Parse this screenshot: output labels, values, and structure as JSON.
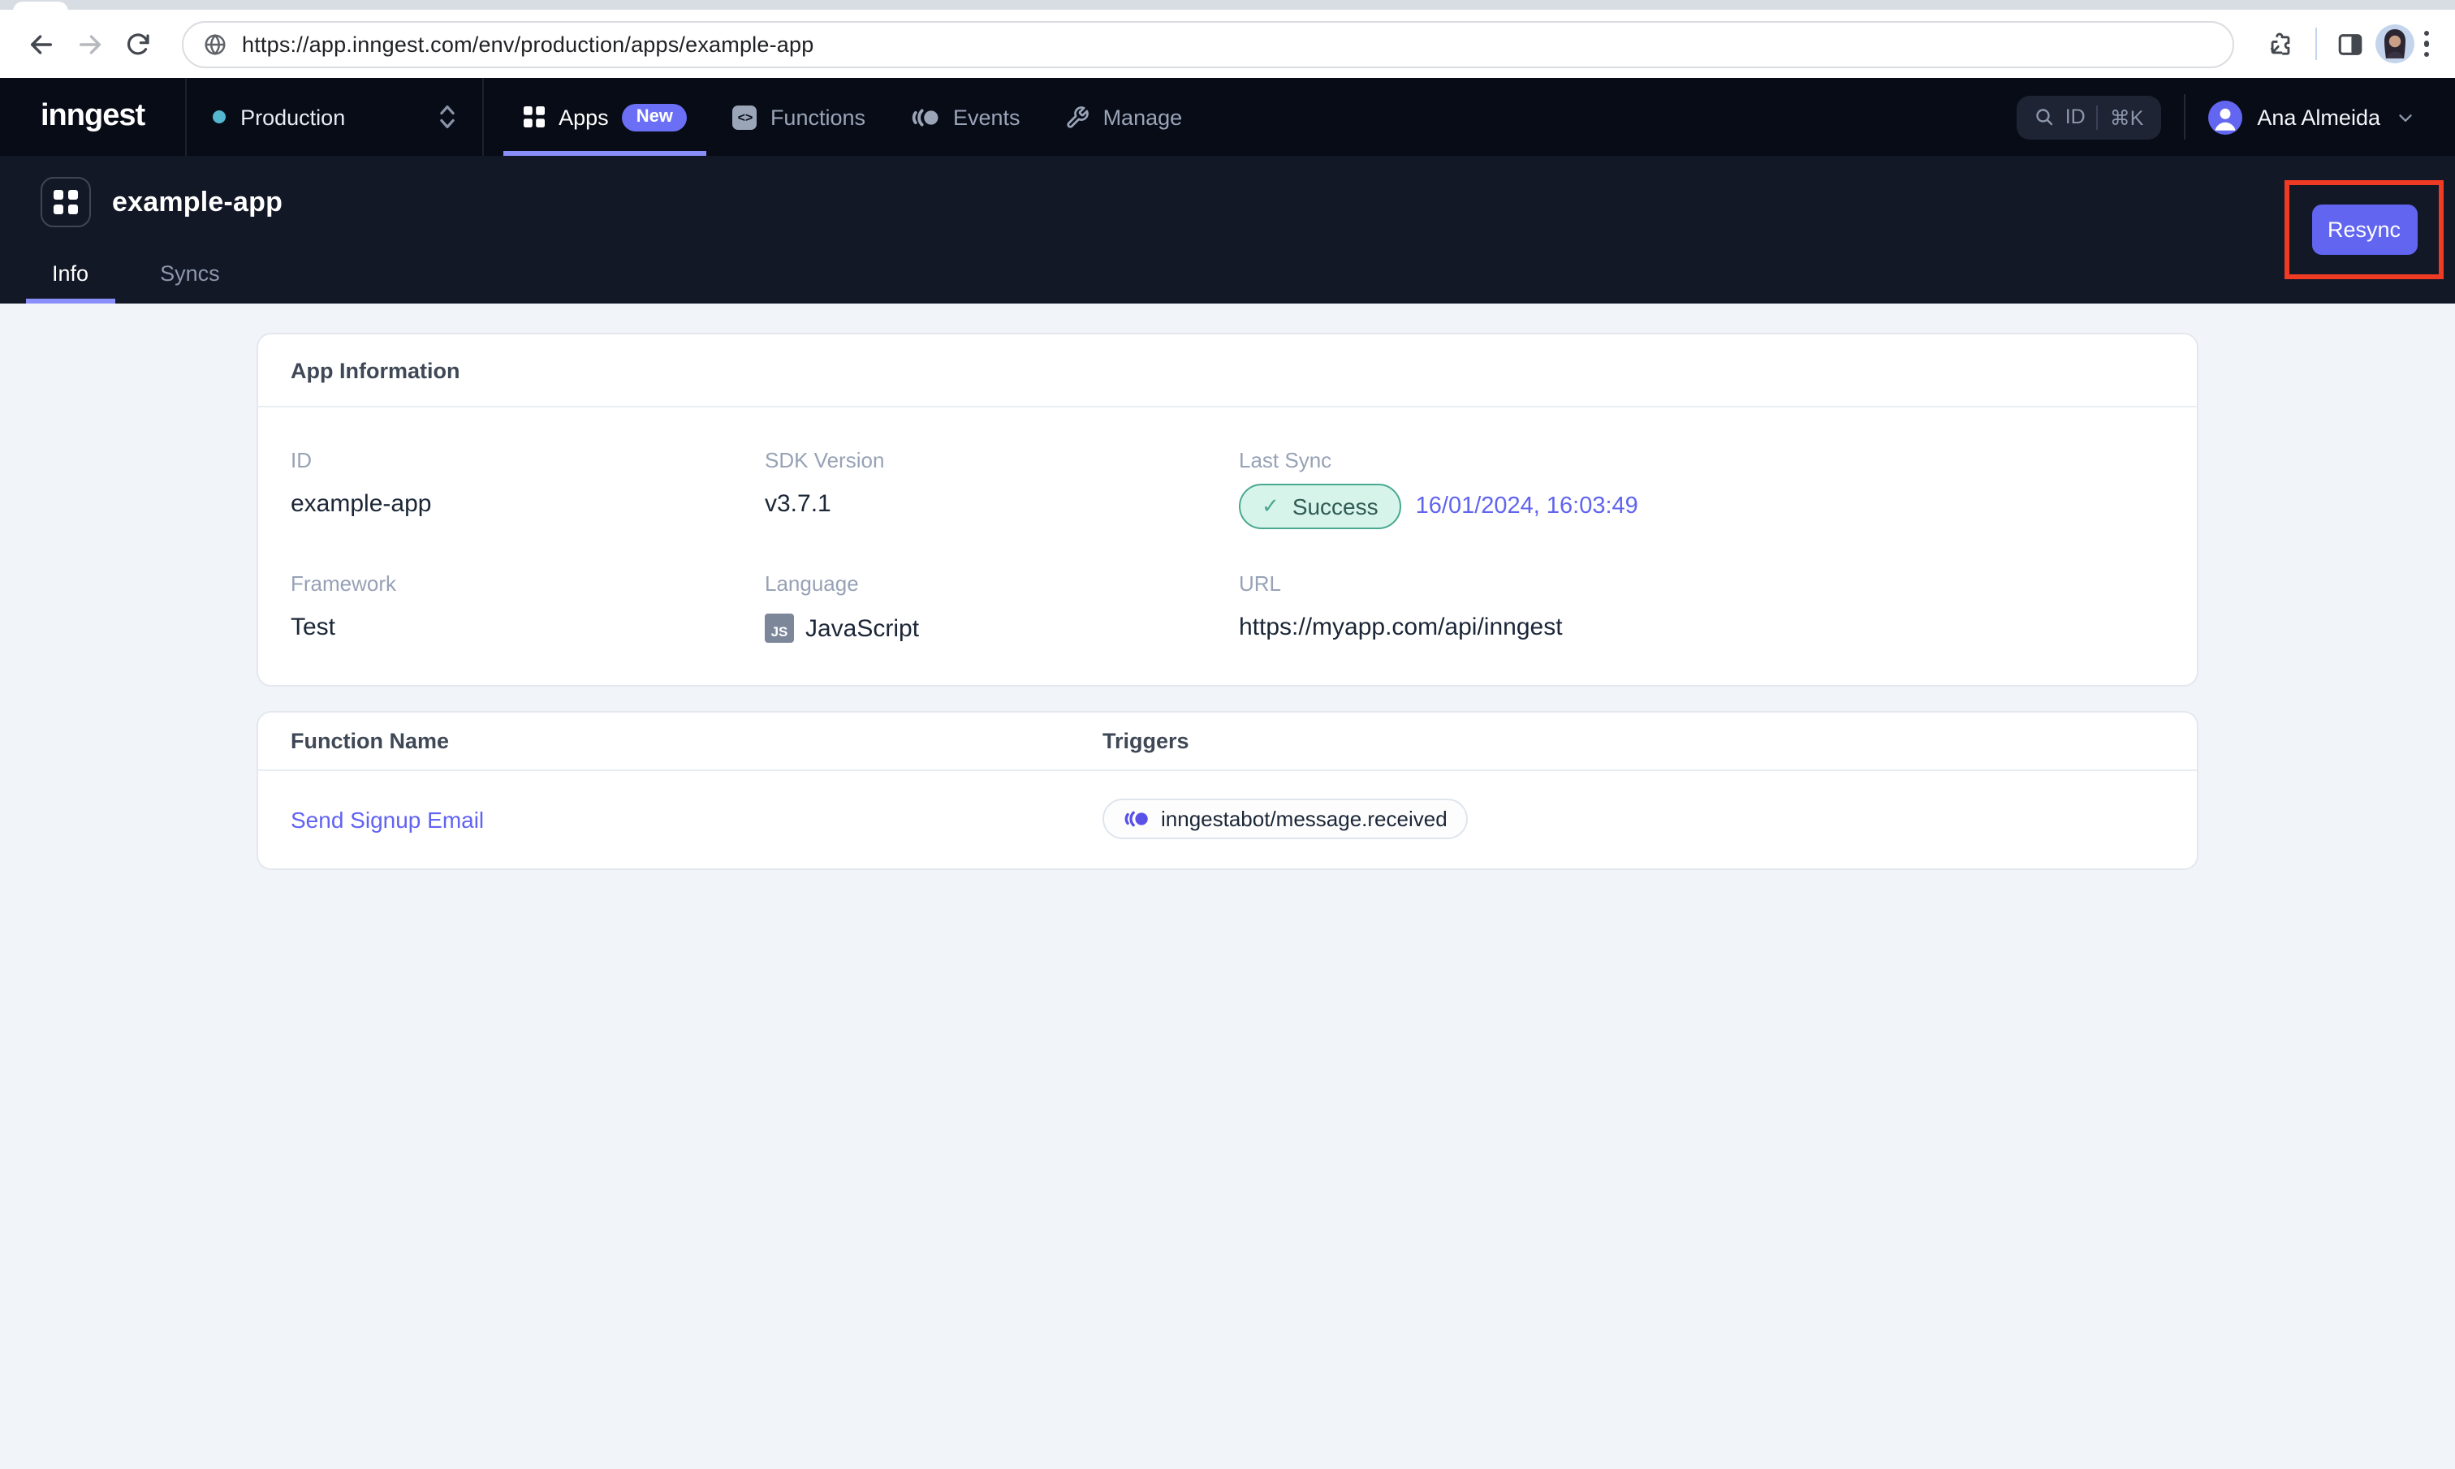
{
  "browser": {
    "url": "https://app.inngest.com/env/production/apps/example-app"
  },
  "navbar": {
    "logo": "inngest",
    "environment": {
      "label": "Production"
    },
    "items": [
      {
        "label": "Apps",
        "badge": "New"
      },
      {
        "label": "Functions"
      },
      {
        "label": "Events"
      },
      {
        "label": "Manage"
      }
    ],
    "search": {
      "label": "ID",
      "shortcut": "⌘K"
    },
    "user": {
      "name": "Ana Almeida"
    }
  },
  "page_header": {
    "title": "example-app",
    "tabs": [
      {
        "label": "Info"
      },
      {
        "label": "Syncs"
      }
    ],
    "resync_label": "Resync"
  },
  "app_info": {
    "title": "App Information",
    "fields": {
      "id": {
        "label": "ID",
        "value": "example-app"
      },
      "sdk_version": {
        "label": "SDK Version",
        "value": "v3.7.1"
      },
      "last_sync": {
        "label": "Last Sync",
        "status": "Success",
        "timestamp": "16/01/2024, 16:03:49"
      },
      "framework": {
        "label": "Framework",
        "value": "Test"
      },
      "language": {
        "label": "Language",
        "badge": "JS",
        "value": "JavaScript"
      },
      "url": {
        "label": "URL",
        "value": "https://myapp.com/api/inngest"
      }
    }
  },
  "functions_table": {
    "headers": {
      "name": "Function Name",
      "triggers": "Triggers"
    },
    "rows": [
      {
        "name": "Send Signup Email",
        "trigger": "inngestabot/message.received"
      }
    ]
  },
  "icons": {
    "functions_glyph": "<>",
    "check": "✓"
  },
  "colors": {
    "accent": "#6366f1",
    "nav_background": "#080c17",
    "header_background": "#131827",
    "success_background": "#d7f4ea",
    "success_border": "#4aa890",
    "success_text": "#2f5a52",
    "timestamp": "#6064ee",
    "annotation_highlight": "#ef3b24",
    "tab_indicator": "#8a8ef8"
  }
}
